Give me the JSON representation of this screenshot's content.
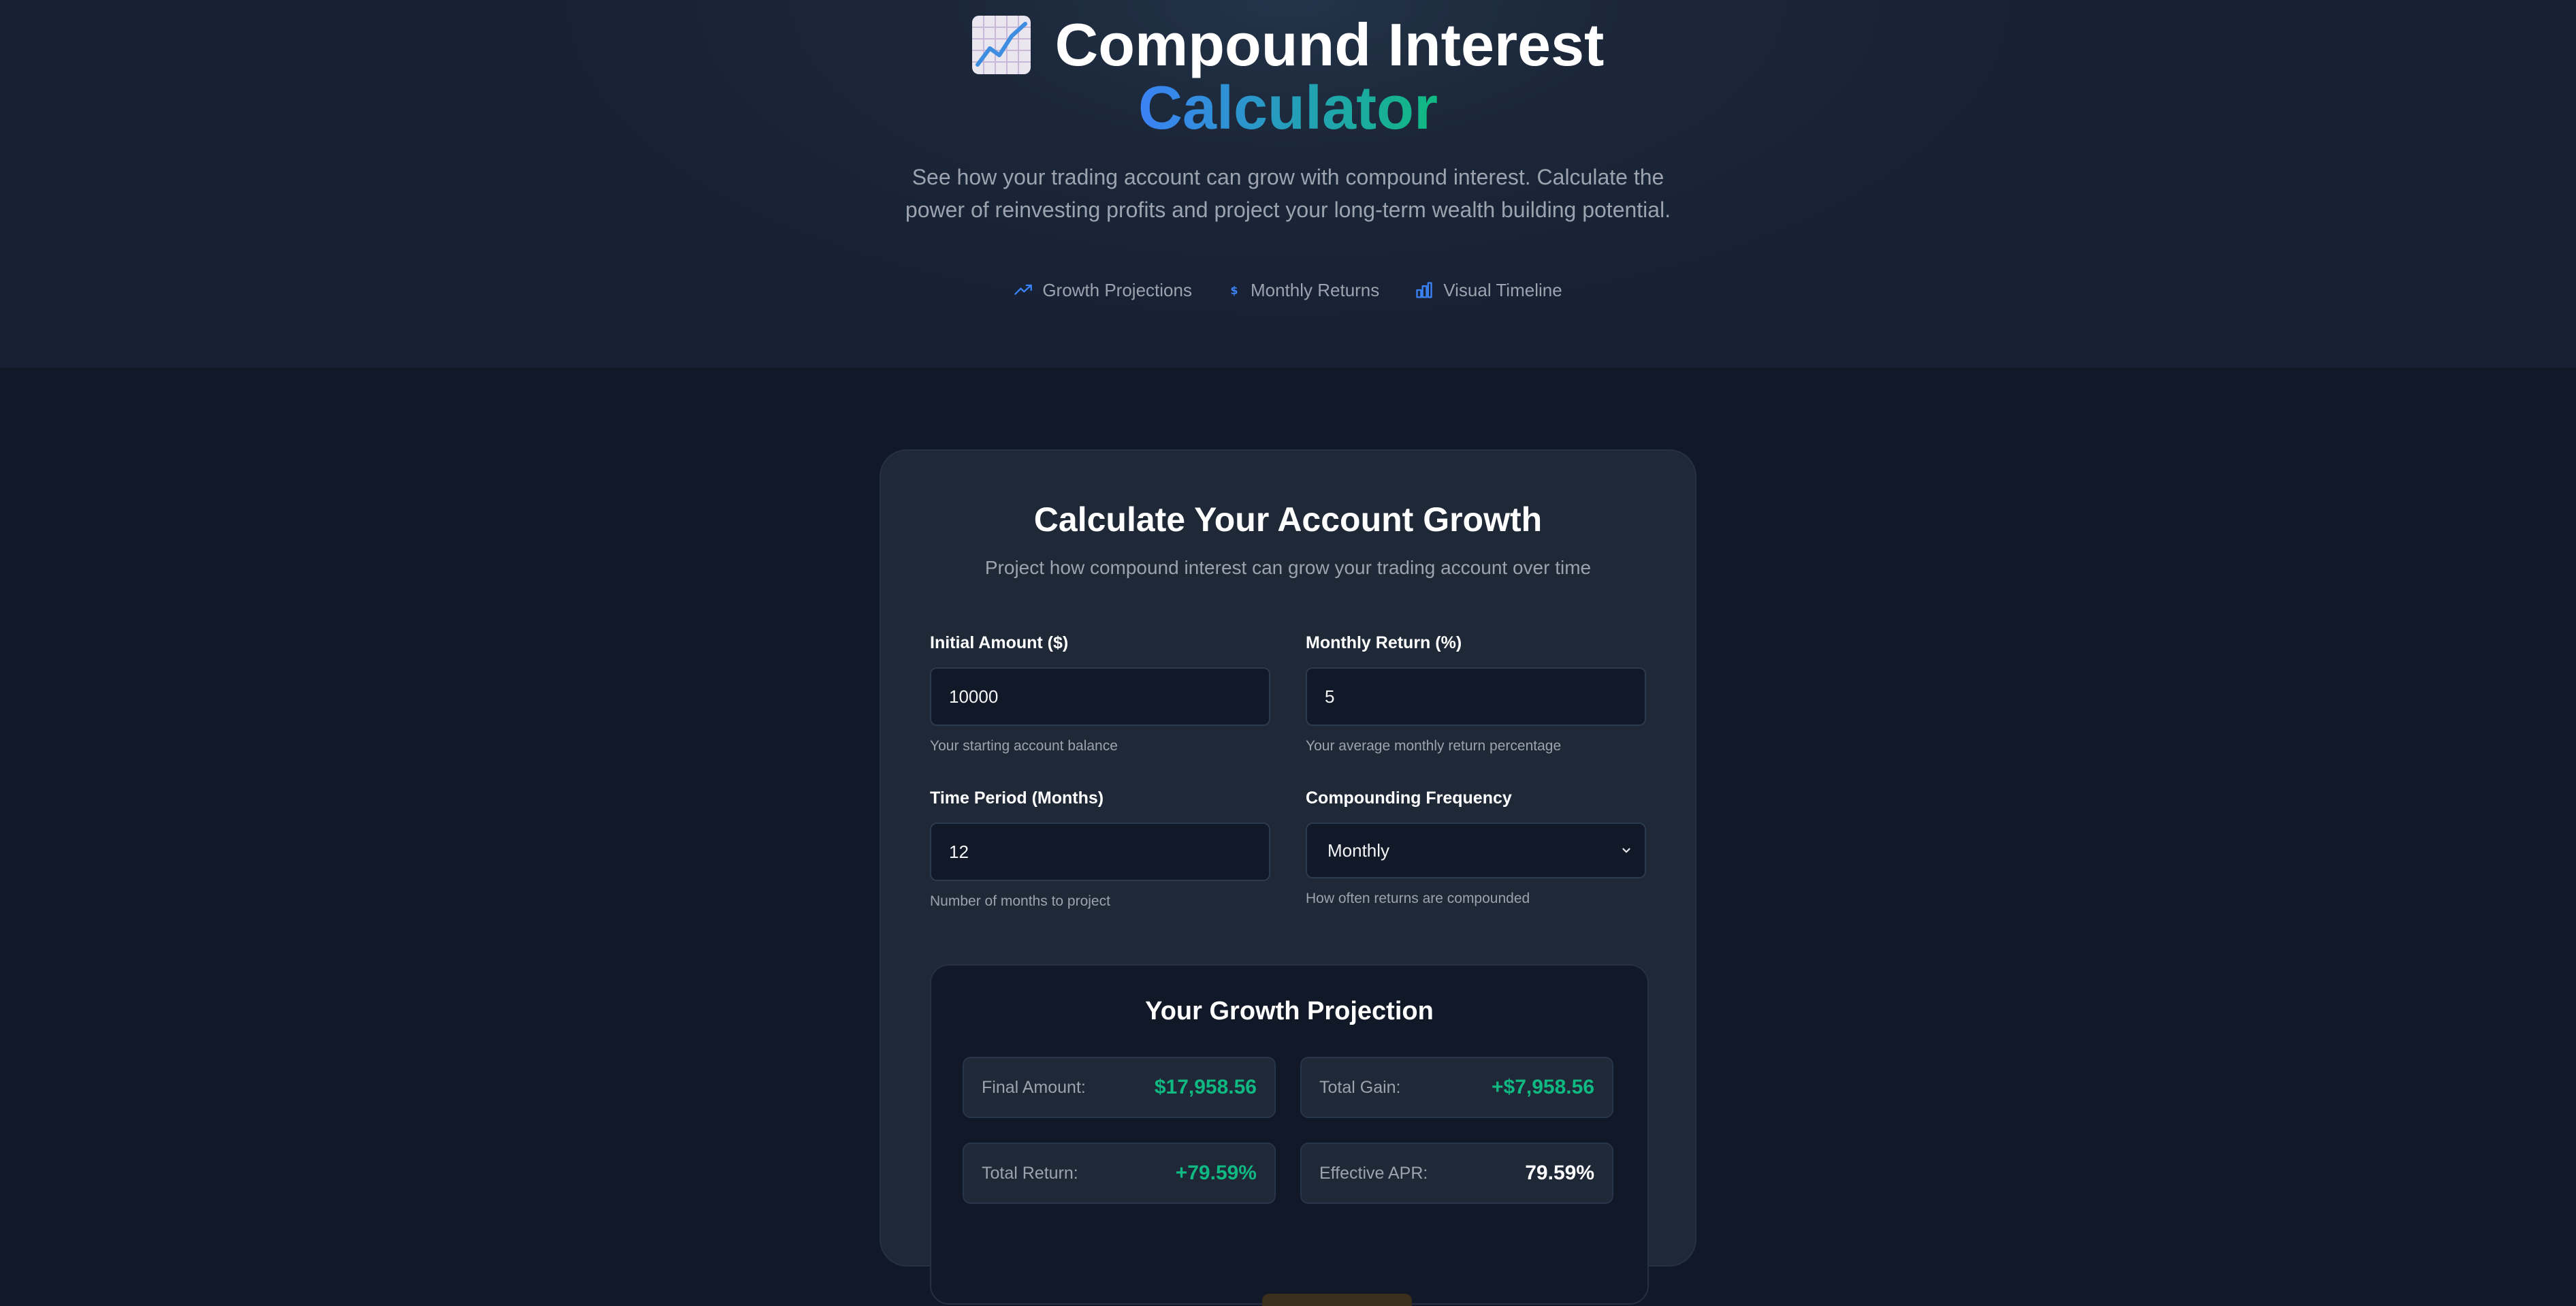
{
  "header": {
    "title_main": "Compound Interest",
    "title_accent": "Calculator",
    "title_icon": "chart-increasing-icon",
    "subtitle": "See how your trading account can grow with compound interest. Calculate the power of reinvesting profits and project your long-term wealth building potential.",
    "features": [
      {
        "icon": "trending-up-icon",
        "label": "Growth Projections"
      },
      {
        "icon": "dollar-icon",
        "label": "Monthly Returns"
      },
      {
        "icon": "bar-chart-icon",
        "label": "Visual Timeline"
      }
    ]
  },
  "calculator": {
    "title": "Calculate Your Account Growth",
    "subtitle": "Project how compound interest can grow your trading account over time",
    "fields": {
      "initial_amount": {
        "label": "Initial Amount ($)",
        "value": "10000",
        "help": "Your starting account balance"
      },
      "monthly_return": {
        "label": "Monthly Return (%)",
        "value": "5",
        "help": "Your average monthly return percentage"
      },
      "time_period": {
        "label": "Time Period (Months)",
        "value": "12",
        "help": "Number of months to project"
      },
      "frequency": {
        "label": "Compounding Frequency",
        "value": "Monthly",
        "help": "How often returns are compounded"
      }
    }
  },
  "results": {
    "title": "Your Growth Projection",
    "stats": [
      {
        "label": "Final Amount:",
        "value": "$17,958.56"
      },
      {
        "label": "Total Gain:",
        "value": "+$7,958.56"
      },
      {
        "label": "Total Return:",
        "value": "+79.59%"
      },
      {
        "label": "Effective APR:",
        "value": "79.59%"
      }
    ]
  },
  "colors": {
    "background": "#111827",
    "card": "#1e2837",
    "accent_blue": "#3b82f6",
    "accent_green": "#10b981",
    "muted_text": "#9ca3af"
  }
}
